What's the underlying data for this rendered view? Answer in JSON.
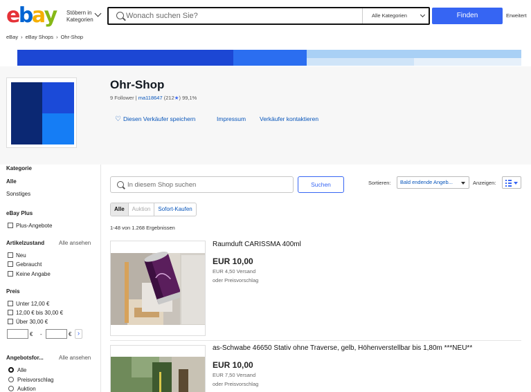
{
  "header": {
    "logo_letters": [
      {
        "char": "e",
        "color": "#e53238"
      },
      {
        "char": "b",
        "color": "#0064d2"
      },
      {
        "char": "a",
        "color": "#f5af02"
      },
      {
        "char": "y",
        "color": "#86b817"
      }
    ],
    "browse_label": "Stöbern in Kategorien",
    "search_placeholder": "Wonach suchen Sie?",
    "category_select": "Alle Kategorien",
    "find_button": "Finden",
    "advanced_link": "Erweitert"
  },
  "breadcrumb": [
    "eBay",
    "eBay Shops",
    "Ohr-Shop"
  ],
  "banner": {
    "colors": [
      "#1c47d4",
      "#2b6ef0",
      "#bfdcf7",
      "#dce9f7"
    ]
  },
  "store": {
    "logo_colors": {
      "top_left": "#0b2873",
      "top_right": "#1b4ad8",
      "bottom_left": "#0b2873",
      "bottom_right": "#157df5"
    },
    "title": "Ohr-Shop",
    "followers": "9 Follower",
    "seller": "ma118647",
    "feedback_count": "(212",
    "feedback_star": "★",
    "feedback_close": ")",
    "feedback_percent": "99,1%",
    "save_seller": "Diesen Verkäufer speichern",
    "impressum": "Impressum",
    "contact_seller": "Verkäufer kontaktieren"
  },
  "sidebar": {
    "category_heading": "Kategorie",
    "category_all": "Alle",
    "category_other": "Sonstiges",
    "ebay_plus_heading": "eBay Plus",
    "plus_offers": "Plus-Angebote",
    "condition_heading": "Artikelzustand",
    "condition_see_all": "Alle ansehen",
    "condition_items": [
      "Neu",
      "Gebraucht",
      "Keine Angabe"
    ],
    "price_heading": "Preis",
    "price_items": [
      "Unter 12,00 €",
      "12,00 € bis 30,00 €",
      "Über 30,00 €"
    ],
    "currency_symbol": "€",
    "range_dash": "-",
    "go_chevron": "›",
    "format_heading": "Angebotsfor...",
    "format_see_all": "Alle ansehen",
    "format_items": [
      "Alle",
      "Preisvorschlag",
      "Auktion"
    ],
    "format_selected": "Alle"
  },
  "main": {
    "store_search_placeholder": "In diesem Shop suchen",
    "store_search_button": "Suchen",
    "sort_label": "Sortieren:",
    "sort_value": "Bald endende Angeb...",
    "view_label": "Anzeigen:",
    "filter_tabs": [
      "Alle",
      "Auktion",
      "Sofort-Kaufen"
    ],
    "result_count": "1-48 von 1.268 Ergebnissen",
    "items": [
      {
        "title": "Raumduft CARISSMA 400ml",
        "price": "EUR 10,00",
        "shipping": "EUR 4,50 Versand",
        "offer": "oder Preisvorschlag"
      },
      {
        "title": "as-Schwabe 46650 Stativ ohne Traverse, gelb, Höhenverstellbar bis 1,80m ***NEU**",
        "price": "EUR 10,00",
        "shipping": "EUR 7,50 Versand",
        "offer": "oder Preisvorschlag"
      }
    ]
  }
}
